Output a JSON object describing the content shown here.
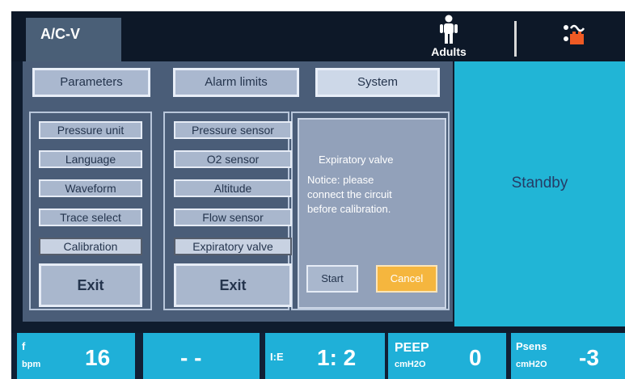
{
  "topbar": {
    "mode": "A/C-V",
    "patient_type": "Adults"
  },
  "tabs": {
    "parameters": "Parameters",
    "alarm_limits": "Alarm limits",
    "system": "System"
  },
  "left_column": {
    "items": [
      "Pressure unit",
      "Language",
      "Waveform",
      "Trace select",
      "Calibration"
    ],
    "exit": "Exit"
  },
  "middle_column": {
    "items": [
      "Pressure sensor",
      "O2 sensor",
      "Altitude",
      "Flow sensor",
      "Expiratory valve"
    ],
    "exit": "Exit"
  },
  "calibration_panel": {
    "title": "Expiratory valve",
    "notice": "Notice: please\nconnect the circuit\nbefore calibration.",
    "start": "Start",
    "cancel": "Cancel"
  },
  "status": "Standby",
  "bottom_params": [
    {
      "label": "f",
      "unit": "bpm",
      "value": "16"
    },
    {
      "label": "",
      "unit": "",
      "value": "- -"
    },
    {
      "label": "I:E",
      "unit": "",
      "value": "1: 2"
    },
    {
      "label": "PEEP",
      "unit": "cmH2O",
      "value": "0"
    },
    {
      "label": "Psens",
      "unit": "cmH2O",
      "value": "-3"
    }
  ],
  "colors": {
    "accent": "#21b5d6",
    "panel": "#4a5d78",
    "cancel": "#f5b63e"
  }
}
